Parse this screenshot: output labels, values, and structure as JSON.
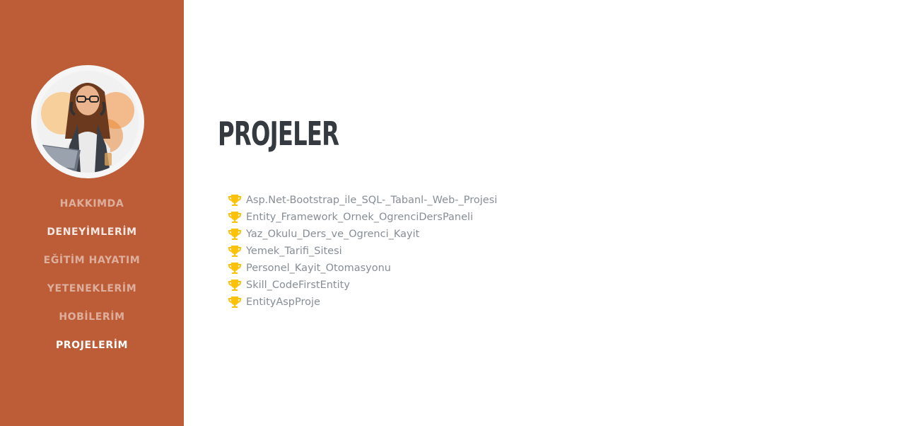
{
  "theme": {
    "sidebar_color": "#bd5d38",
    "title_color": "#343a40",
    "text_color": "#868e96",
    "icon_color": "#ffc107"
  },
  "sidebar": {
    "avatar_icon": "profile-photo",
    "items": [
      {
        "label": "HAKKIMDA",
        "state": "dim"
      },
      {
        "label": "DENEYİMLERİM",
        "state": "bright"
      },
      {
        "label": "EĞİTİM HAYATIM",
        "state": "dim"
      },
      {
        "label": "YETENEKLERİM",
        "state": "dim"
      },
      {
        "label": "HOBİLERİM",
        "state": "dim"
      },
      {
        "label": "PROJELERİM",
        "state": "active"
      }
    ]
  },
  "main": {
    "title": "PROJELER",
    "item_icon": "trophy-icon",
    "projects": [
      "Asp.Net-Bootstrap_ile_SQL-_Tabanl-_Web-_Projesi",
      "Entity_Framework_Ornek_OgrenciDersPaneli",
      "Yaz_Okulu_Ders_ve_Ogrenci_Kayit",
      "Yemek_Tarifi_Sitesi",
      "Personel_Kayit_Otomasyonu",
      "Skill_CodeFirstEntity",
      "EntityAspProje"
    ]
  }
}
